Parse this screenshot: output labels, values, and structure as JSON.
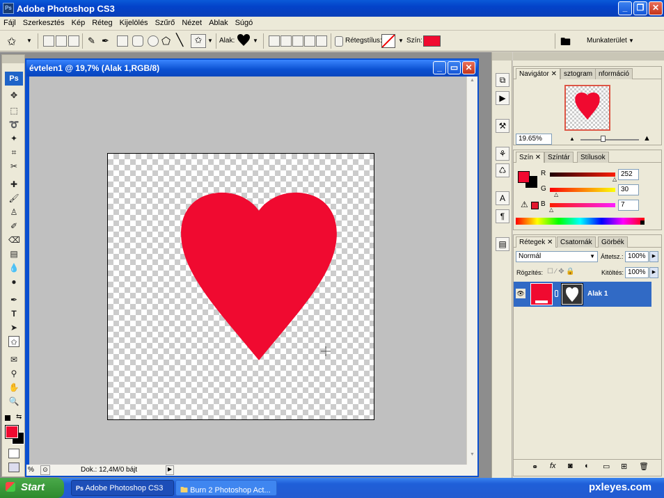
{
  "app": {
    "title": "Adobe Photoshop CS3",
    "icon": "Ps"
  },
  "menu": [
    "Fájl",
    "Szerkesztés",
    "Kép",
    "Réteg",
    "Kijelölés",
    "Szűrő",
    "Nézet",
    "Ablak",
    "Súgó"
  ],
  "options": {
    "shape_label": "Alak:",
    "layer_style_label": "Rétegstílus:",
    "color_label": "Szín:",
    "color_value": "#f00a30",
    "workspace_label": "Munkaterület"
  },
  "toolbox": {
    "badge": "Ps"
  },
  "document": {
    "title": "évtelen1 @ 19,7% (Alak 1,RGB/8)",
    "status_zoom": "%",
    "status_doc": "Dok.: 12,4M/0 bájt"
  },
  "navigator": {
    "tabs": [
      "Navigátor",
      "sztogram",
      "nformáció"
    ],
    "zoom": "19.65%"
  },
  "color_panel": {
    "tabs": [
      "Szín",
      "Színtár",
      "Stílusok"
    ],
    "r_label": "R",
    "g_label": "G",
    "b_label": "B",
    "r": "252",
    "g": "30",
    "b": "7",
    "foreground": "#f00a30"
  },
  "layers_panel": {
    "tabs": [
      "Rétegek",
      "Csatornák",
      "Görbék"
    ],
    "blend_mode": "Normál",
    "opacity_label": "Áttetsz.:",
    "opacity": "100%",
    "lock_label": "Rögzítés:",
    "fill_label": "Kitöltés:",
    "fill": "100%",
    "layer_name": "Alak 1"
  },
  "taskbar": {
    "start": "Start",
    "items": [
      "Adobe Photoshop CS3",
      "Burn 2 Photoshop Act..."
    ]
  },
  "watermark": "pxleyes.com"
}
